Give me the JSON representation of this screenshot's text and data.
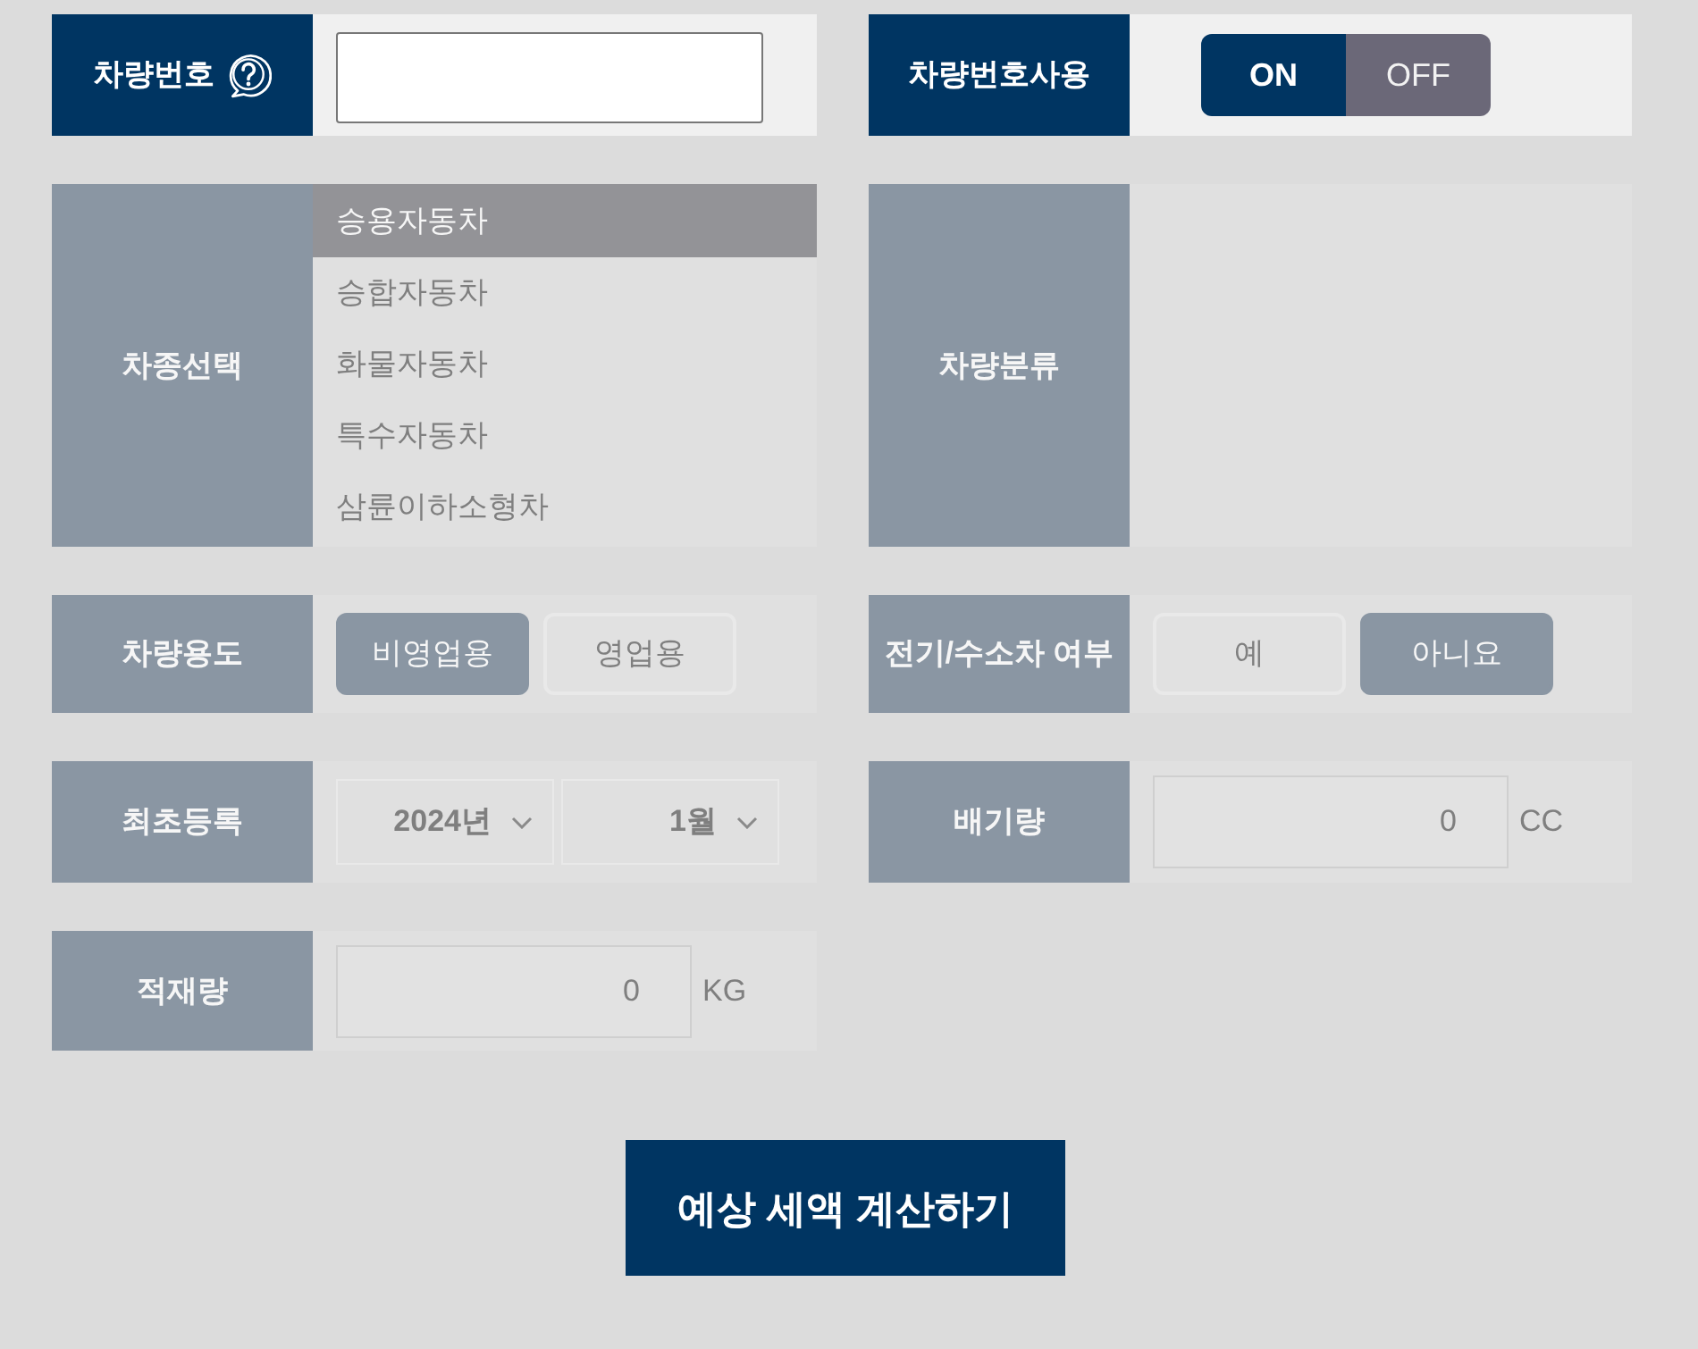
{
  "fields": [
    {
      "kind": "text",
      "label": "차량번호",
      "help": true,
      "disabled": false
    },
    {
      "kind": "toggle",
      "label": "차량번호사용",
      "disabled": false,
      "options": [
        {
          "label": "ON",
          "selected": true
        },
        {
          "label": "OFF",
          "selected": false
        }
      ]
    },
    {
      "kind": "list",
      "label": "차종선택",
      "disabled": true,
      "options": [
        {
          "label": "승용자동차",
          "selected": true
        },
        {
          "label": "승합자동차",
          "selected": false
        },
        {
          "label": "화물자동차",
          "selected": false
        },
        {
          "label": "특수자동차",
          "selected": false
        },
        {
          "label": "삼륜이하소형차",
          "selected": false
        }
      ]
    },
    {
      "kind": "blank",
      "label": "차량분류",
      "disabled": true
    },
    {
      "kind": "choice",
      "label": "차량용도",
      "disabled": true,
      "options": [
        {
          "label": "비영업용",
          "selected": true
        },
        {
          "label": "영업용",
          "selected": false
        }
      ]
    },
    {
      "kind": "choice",
      "label": "전기/수소차 여부",
      "disabled": true,
      "options": [
        {
          "label": "예",
          "selected": false
        },
        {
          "label": "아니요",
          "selected": true
        }
      ]
    },
    {
      "kind": "dropdowns",
      "label": "최초등록",
      "disabled": true,
      "dropdowns": [
        "2024년",
        "1월"
      ]
    },
    {
      "kind": "number",
      "label": "배기량",
      "disabled": true,
      "value": "0",
      "unit": "CC"
    },
    {
      "kind": "number",
      "label": "적재량",
      "disabled": true,
      "value": "0",
      "unit": "KG"
    }
  ],
  "submit_button": {
    "label": "예상 세액 계산하기"
  }
}
